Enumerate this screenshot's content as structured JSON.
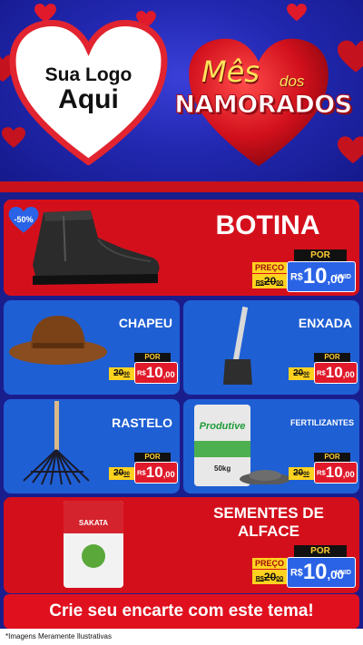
{
  "header": {
    "logo_line1": "Sua Logo",
    "logo_line2": "Aqui",
    "title_mes": "Mês",
    "title_dos": "dos",
    "title_namorados": "NAMORADOS"
  },
  "badge": {
    "discount": "-50%"
  },
  "products": {
    "botina": {
      "name": "BOTINA",
      "por": "POR",
      "preco": "PREÇO",
      "old_int": "20",
      "old_cents": "00",
      "currency": "R$",
      "new_int": "10",
      "new_cents": ",00",
      "unid": "UNID"
    },
    "chapeu": {
      "name": "CHAPEU",
      "por": "POR",
      "old_int": "20",
      "old_cents": "00",
      "currency": "R$",
      "new_int": "10",
      "new_cents": ",00"
    },
    "enxada": {
      "name": "ENXADA",
      "por": "POR",
      "old_int": "20",
      "old_cents": "00",
      "currency": "R$",
      "new_int": "10",
      "new_cents": ",00"
    },
    "rastelo": {
      "name": "RASTELO",
      "por": "POR",
      "old_int": "20",
      "old_cents": "00",
      "currency": "R$",
      "new_int": "10",
      "new_cents": ",00"
    },
    "fertilizantes": {
      "name": "FERTILIZANTES",
      "por": "POR",
      "old_int": "20",
      "old_cents": "00",
      "currency": "R$",
      "new_int": "10",
      "new_cents": ",00",
      "bag_brand": "Produtive",
      "bag_weight": "50kg"
    },
    "sementes": {
      "name_line1": "SEMENTES DE",
      "name_line2": "ALFACE",
      "por": "POR",
      "preco": "PREÇO",
      "old_int": "20",
      "old_cents": "00",
      "currency": "R$",
      "new_int": "10",
      "new_cents": ",00",
      "unid": "UNID",
      "pack_brand": "SAKATA"
    }
  },
  "footer": {
    "cta": "Crie seu encarte com este tema!",
    "note": "*Imagens Meramente Ilustrativas"
  },
  "colors": {
    "red": "#d40f1c",
    "blue_card": "#1f5fd4",
    "header_blue": "#2228b0",
    "price_yellow": "#ffd21f",
    "price_blue": "#2a63e6"
  }
}
